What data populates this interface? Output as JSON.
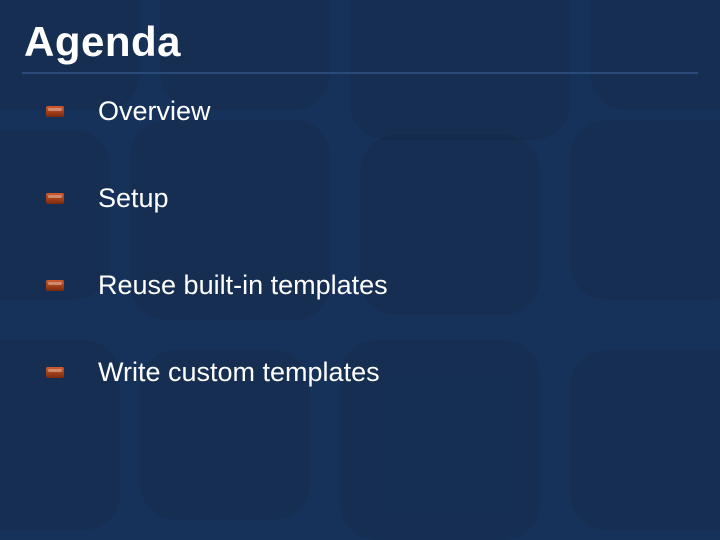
{
  "title": "Agenda",
  "bullets": [
    {
      "label": "Overview"
    },
    {
      "label": "Setup"
    },
    {
      "label": "Reuse built-in templates"
    },
    {
      "label": "Write custom templates"
    }
  ]
}
